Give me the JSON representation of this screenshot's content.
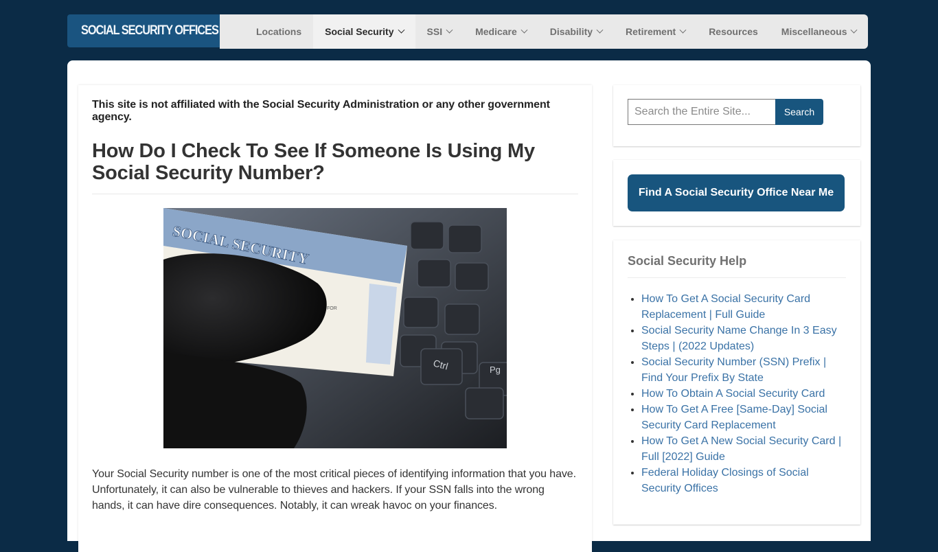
{
  "header": {
    "logo_text": "SOCIAL SECURITY OFFICES",
    "logo_icon": "building-icon",
    "nav": [
      {
        "label": "Locations",
        "dropdown": false,
        "active": false
      },
      {
        "label": "Social Security",
        "dropdown": true,
        "active": true
      },
      {
        "label": "SSI",
        "dropdown": true,
        "active": false
      },
      {
        "label": "Medicare",
        "dropdown": true,
        "active": false
      },
      {
        "label": "Disability",
        "dropdown": true,
        "active": false
      },
      {
        "label": "Retirement",
        "dropdown": true,
        "active": false
      },
      {
        "label": "Resources",
        "dropdown": false,
        "active": false
      },
      {
        "label": "Miscellaneous",
        "dropdown": true,
        "active": false
      }
    ]
  },
  "main": {
    "disclaimer": "This site is not affiliated with the Social Security Administration or any other government agency.",
    "title": "How Do I Check To See If Someone Is Using My Social Security Number?",
    "hero_image": {
      "description": "Gloved hand holding a Social Security card over a keyboard",
      "card_text": "SOCIAL SECURITY",
      "card_for": "FOR",
      "key_labels": [
        "Ctrl",
        "Pg"
      ]
    },
    "intro": "Your Social Security number is one of the most critical pieces of identifying information that you have. Unfortunately, it can also be vulnerable to thieves and hackers. If your SSN falls into the wrong hands, it can have dire consequences. Notably, it can wreak havoc on your finances."
  },
  "sidebar": {
    "search": {
      "placeholder": "Search the Entire Site...",
      "value": "",
      "button": "Search"
    },
    "find_office_button": "Find A Social Security Office Near Me",
    "help": {
      "title": "Social Security Help",
      "links": [
        "How To Get A Social Security Card Replacement | Full Guide",
        "Social Security Name Change In 3 Easy Steps | (2022 Updates)",
        "Social Security Number (SSN) Prefix | Find Your Prefix By State",
        "How To Obtain A Social Security Card",
        "How To Get A Free [Same-Day] Social Security Card Replacement",
        "How To Get A New Social Security Card | Full [2022] Guide",
        "Federal Holiday Closings of Social Security Offices"
      ]
    }
  },
  "colors": {
    "background": "#0b2b46",
    "brand": "#18557e",
    "nav_bg": "#e9e9e9",
    "link": "#3a72a6"
  }
}
